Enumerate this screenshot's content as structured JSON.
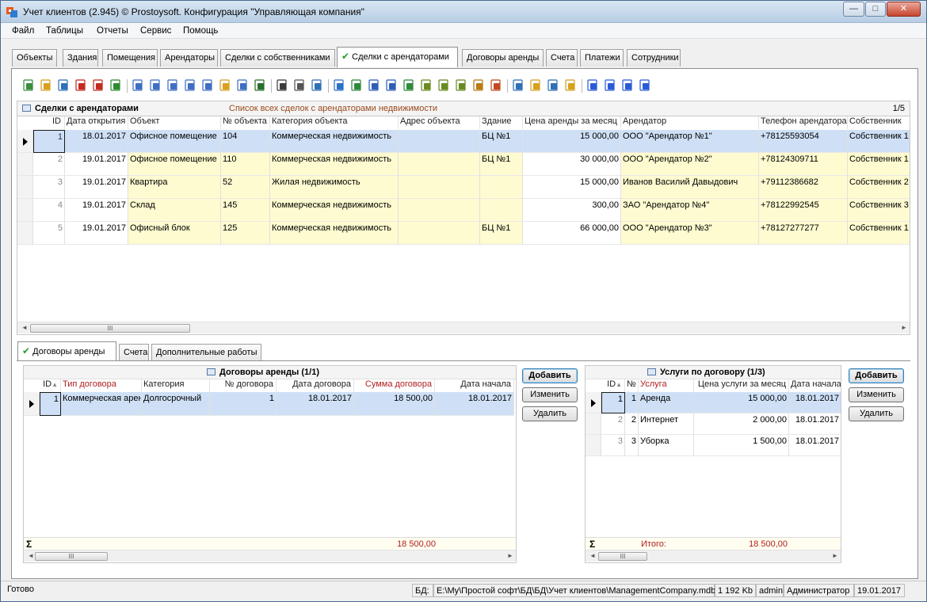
{
  "window": {
    "title": "Учет клиентов (2.945) © Prostoysoft. Конфигурация \"Управляющая компания\"",
    "controls": {
      "minimize": "—",
      "maximize": "□",
      "close": "✕"
    }
  },
  "menu": [
    "Файл",
    "Таблицы",
    "Отчеты",
    "Сервис",
    "Помощь"
  ],
  "tabs": [
    {
      "label": "Объекты"
    },
    {
      "label": "Здания"
    },
    {
      "label": "Помещения"
    },
    {
      "label": "Арендаторы"
    },
    {
      "label": "Сделки с собственниками"
    },
    {
      "label": "Сделки с арендаторами",
      "active": true
    },
    {
      "label": "Договоры аренды"
    },
    {
      "label": "Счета"
    },
    {
      "label": "Платежи"
    },
    {
      "label": "Сотрудники"
    }
  ],
  "check_mark": "✔",
  "toolbar_icons": [
    "add-record-icon",
    "edit-icon",
    "copy-icon",
    "delete-icon",
    "delete-multiple-icon",
    "refresh-icon",
    "filter-icon",
    "filter-remove-icon",
    "filter-clear-icon",
    "filter-edit-icon",
    "filter-set-icon",
    "filter-cascade-icon",
    "filter-advanced-icon",
    "sql-filter-icon",
    "find-icon",
    "print-icon",
    "print-preview-icon",
    "export-icon",
    "export-excel-icon",
    "export-word-icon",
    "export-word2-icon",
    "export-excel2-icon",
    "export-xml-icon",
    "export-csv-icon",
    "export-text-icon",
    "export-html-icon",
    "chart-icon",
    "sort-ascending-icon",
    "sort-descending-icon",
    "columns-icon",
    "settings-icon",
    "first-record-icon",
    "prev-record-icon",
    "next-record-icon",
    "last-record-icon"
  ],
  "deals": {
    "title": "Сделки с арендаторами",
    "subtitle": "Список всех сделок с арендаторами недвижимости",
    "pager": "1/5",
    "columns": [
      "ID",
      "Дата открытия",
      "Объект",
      "№ объекта",
      "Категория объекта",
      "Адрес объекта",
      "Здание",
      "Цена аренды за месяц",
      "Арендатор",
      "Телефон арендатора",
      "Собственник"
    ],
    "rows": [
      {
        "id": "1",
        "date": "18.01.2017",
        "object": "Офисное помещение",
        "num": "104",
        "category": "Коммерческая недвижимость",
        "address": "",
        "building": "БЦ №1",
        "price": "15 000,00",
        "tenant": "ООО \"Арендатор №1\"",
        "phone": "+78125593054",
        "owner": "Собственник 1"
      },
      {
        "id": "2",
        "date": "19.01.2017",
        "object": "Офисное помещение",
        "num": "110",
        "category": "Коммерческая недвижимость",
        "address": "",
        "building": "БЦ №1",
        "price": "30 000,00",
        "tenant": "ООО \"Арендатор №2\"",
        "phone": "+78124309711",
        "owner": "Собственник 1"
      },
      {
        "id": "3",
        "date": "19.01.2017",
        "object": "Квартира",
        "num": "52",
        "category": "Жилая недвижимость",
        "address": "",
        "building": "",
        "price": "15 000,00",
        "tenant": "Иванов Василий Давыдович",
        "phone": "+79112386682",
        "owner": "Собственник 2"
      },
      {
        "id": "4",
        "date": "19.01.2017",
        "object": "Склад",
        "num": "145",
        "category": "Коммерческая недвижимость",
        "address": "",
        "building": "",
        "price": "300,00",
        "tenant": "ЗАО \"Арендатор №4\"",
        "phone": "+78122992545",
        "owner": "Собственник 3"
      },
      {
        "id": "5",
        "date": "19.01.2017",
        "object": "Офисный блок",
        "num": "125",
        "category": "Коммерческая недвижимость",
        "address": "",
        "building": "БЦ №1",
        "price": "66 000,00",
        "tenant": "ООО \"Арендатор №3\"",
        "phone": "+78127277277",
        "owner": "Собственник 1"
      }
    ]
  },
  "subtabs": [
    {
      "label": "Договоры аренды",
      "active": true
    },
    {
      "label": "Счета"
    },
    {
      "label": "Дополнительные работы"
    }
  ],
  "contracts": {
    "title": "Договоры аренды (1/1)",
    "columns": [
      "ID",
      "Тип договора",
      "Категория",
      "№ договора",
      "Дата договора",
      "Сумма договора",
      "Дата начала"
    ],
    "sort_mark": "▲",
    "rows": [
      {
        "id": "1",
        "type": "Коммерческая аренда",
        "category": "Долгосрочный",
        "num": "1",
        "date": "18.01.2017",
        "sum": "18 500,00",
        "start": "18.01.2017"
      }
    ],
    "footer_symbol": "Σ",
    "footer_sum": "18 500,00",
    "buttons": {
      "add": "Добавить",
      "edit": "Изменить",
      "delete": "Удалить"
    }
  },
  "services": {
    "title": "Услуги по договору (1/3)",
    "columns": [
      "ID",
      "№",
      "Услуга",
      "Цена услуги за месяц",
      "Дата начала"
    ],
    "rows": [
      {
        "id": "1",
        "num": "1",
        "service": "Аренда",
        "price": "15 000,00",
        "date": "18.01.2017"
      },
      {
        "id": "2",
        "num": "2",
        "service": "Интернет",
        "price": "2 000,00",
        "date": "18.01.2017"
      },
      {
        "id": "3",
        "num": "3",
        "service": "Уборка",
        "price": "1 500,00",
        "date": "18.01.2017"
      }
    ],
    "footer_symbol": "Σ",
    "footer_label": "Итого:",
    "footer_sum": "18 500,00",
    "buttons": {
      "add": "Добавить",
      "edit": "Изменить",
      "delete": "Удалить"
    }
  },
  "status": {
    "ready": "Готово",
    "db_label": "БД:",
    "db_path": "E:\\Мy\\Простой софт\\БД\\БД\\Учет клиентов\\ManagementCompany.mdb",
    "db_size": "1 192 Kb",
    "user": "admin",
    "role": "Администратор",
    "date": "19.01.2017"
  },
  "scroll_thumb": "III"
}
